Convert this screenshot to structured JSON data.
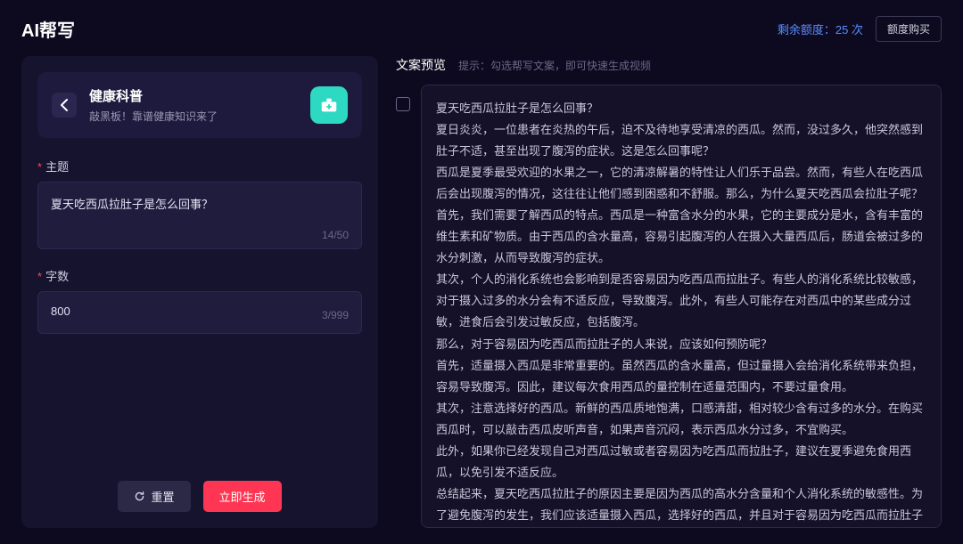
{
  "topbar": {
    "title": "AI帮写",
    "quota_label": "剩余额度：",
    "quota_count": "25 次",
    "buy_label": "额度购买"
  },
  "left": {
    "category_title": "健康科普",
    "category_sub": "敲黑板！靠谱健康知识来了",
    "topic_label": "主题",
    "topic_value": "夏天吃西瓜拉肚子是怎么回事？",
    "topic_count": "14/50",
    "words_label": "字数",
    "words_value": "800",
    "words_count": "3/999",
    "reset_label": "重置",
    "generate_label": "立即生成"
  },
  "right": {
    "preview_title": "文案预览",
    "preview_hint": "提示：勾选帮写文案，即可快速生成视频",
    "paragraphs": [
      "夏天吃西瓜拉肚子是怎么回事？",
      "夏日炎炎，一位患者在炎热的午后，迫不及待地享受清凉的西瓜。然而，没过多久，他突然感到肚子不适，甚至出现了腹泻的症状。这是怎么回事呢？",
      "西瓜是夏季最受欢迎的水果之一，它的清凉解暑的特性让人们乐于品尝。然而，有些人在吃西瓜后会出现腹泻的情况，这往往让他们感到困惑和不舒服。那么，为什么夏天吃西瓜会拉肚子呢？",
      "首先，我们需要了解西瓜的特点。西瓜是一种富含水分的水果，它的主要成分是水，含有丰富的维生素和矿物质。由于西瓜的含水量高，容易引起腹泻的人在摄入大量西瓜后，肠道会被过多的水分刺激，从而导致腹泻的症状。",
      "其次，个人的消化系统也会影响到是否容易因为吃西瓜而拉肚子。有些人的消化系统比较敏感，对于摄入过多的水分会有不适反应，导致腹泻。此外，有些人可能存在对西瓜中的某些成分过敏，进食后会引发过敏反应，包括腹泻。",
      "那么，对于容易因为吃西瓜而拉肚子的人来说，应该如何预防呢？",
      "首先，适量摄入西瓜是非常重要的。虽然西瓜的含水量高，但过量摄入会给消化系统带来负担，容易导致腹泻。因此，建议每次食用西瓜的量控制在适量范围内，不要过量食用。",
      "其次，注意选择好的西瓜。新鲜的西瓜质地饱满，口感清甜，相对较少含有过多的水分。在购买西瓜时，可以敲击西瓜皮听声音，如果声音沉闷，表示西瓜水分过多，不宜购买。",
      "此外，如果你已经发现自己对西瓜过敏或者容易因为吃西瓜而拉肚子，建议在夏季避免食用西瓜，以免引发不适反应。",
      "总结起来，夏天吃西瓜拉肚子的原因主要是因为西瓜的高水分含量和个人消化系统的敏感性。为了避免腹泻的发生，我们应该适量摄入西瓜，选择好的西瓜，并且对于容易因为吃西瓜而拉肚子的人来说，最好避免食用西瓜。让我们在夏天享受西瓜的同时，也要注意自己的身体健康。"
    ]
  }
}
